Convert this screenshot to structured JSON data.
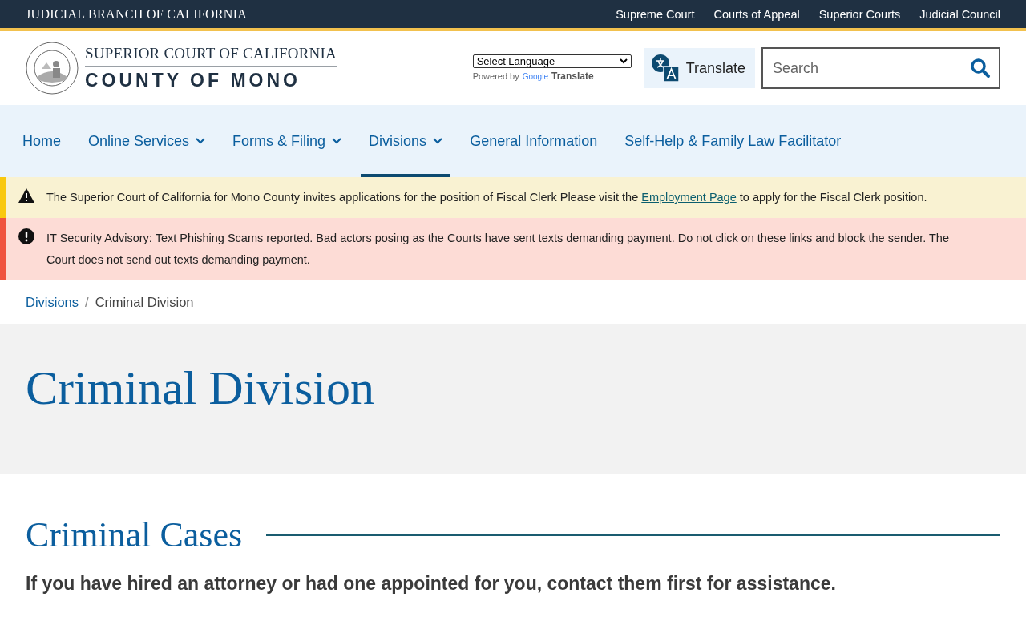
{
  "top_bar": {
    "title": "JUDICIAL BRANCH OF CALIFORNIA",
    "links": [
      "Supreme Court",
      "Courts of Appeal",
      "Superior Courts",
      "Judicial Council"
    ]
  },
  "header": {
    "logo_line_1": "SUPERIOR COURT OF CALIFORNIA",
    "logo_line_2": "COUNTY OF MONO",
    "language_select": "Select Language",
    "powered_by": "Powered by",
    "google": "Google",
    "google_translate": "Translate",
    "translate_button": "Translate",
    "search": {
      "placeholder": "Search"
    }
  },
  "nav": [
    {
      "label": "Home",
      "dropdown": false,
      "selected": false
    },
    {
      "label": "Online Services",
      "dropdown": true,
      "selected": false
    },
    {
      "label": "Forms & Filing",
      "dropdown": true,
      "selected": false
    },
    {
      "label": "Divisions",
      "dropdown": true,
      "selected": true
    },
    {
      "label": "General Information",
      "dropdown": false,
      "selected": false
    },
    {
      "label": "Self-Help & Family Law Facilitator",
      "dropdown": false,
      "selected": false
    }
  ],
  "alerts": [
    {
      "kind": "warning",
      "segments": [
        {
          "kind": "text",
          "text": "The Superior Court of California for Mono County invites applications for the position of Fiscal Clerk Please visit the "
        },
        {
          "kind": "link",
          "text": "Employment Page"
        },
        {
          "kind": "text",
          "text": " to apply for the Fiscal Clerk position."
        }
      ]
    },
    {
      "kind": "danger",
      "segments": [
        {
          "kind": "text",
          "text": "IT Security Advisory: Text Phishing Scams reported. Bad actors posing as the Courts have sent texts demanding payment. Do not click on these links and block the sender. The Court does not send out texts demanding payment."
        }
      ]
    }
  ],
  "breadcrumb": [
    {
      "label": "Divisions",
      "link": true
    },
    {
      "label": "Criminal Division",
      "link": false
    }
  ],
  "breadcrumb_separator": "/",
  "page_title": "Criminal Division",
  "section_heading": "Criminal Cases",
  "lead": "If you have hired an attorney or had one appointed for you, contact them first for assistance."
}
